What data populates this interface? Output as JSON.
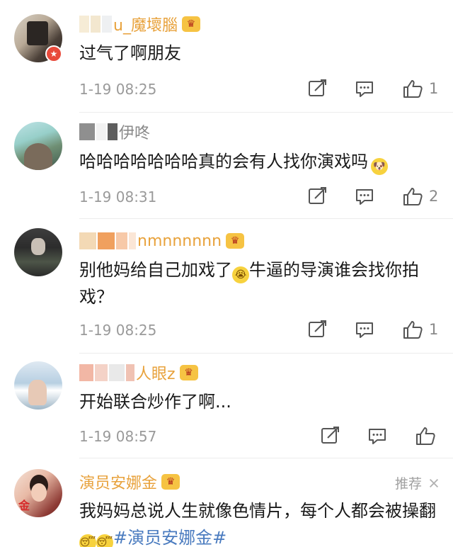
{
  "comments": [
    {
      "username": "u_魔壞腦",
      "text": "过气了啊朋友",
      "time": "1-19 08:25",
      "likes": "1",
      "crown": "♛"
    },
    {
      "username": "伊咚",
      "text": "哈哈哈哈哈哈哈真的会有人找你演戏吗",
      "time": "1-19 08:31",
      "likes": "2"
    },
    {
      "username": "nmnnnnnn",
      "text_part1": "别他妈给自己加戏了",
      "text_part2": "牛逼的导演谁会找你拍戏？",
      "time": "1-19 08:25",
      "likes": "1",
      "crown": "♛"
    },
    {
      "username": "人眼z",
      "text": "开始联合炒作了啊...",
      "time": "1-19 08:57",
      "likes": "",
      "crown": "♛"
    },
    {
      "username": "演员安娜金",
      "recommend_label": "推荐",
      "text_part1": "我妈妈总说人生就像色情片，每个人都会被操翻",
      "hashtag": "#演员安娜金#",
      "crown": "♛",
      "avatar_char": "金"
    }
  ],
  "colors": {
    "time": "#9a9a9a",
    "name": "#8a8a8a",
    "vip_name": "#e8a23c",
    "hashtag": "#4a7bbf",
    "badge": "#e84a3b"
  },
  "icons": {
    "share": "share-icon",
    "comment": "comment-icon",
    "like": "thumbs-up-icon",
    "dismiss": "close-icon"
  }
}
